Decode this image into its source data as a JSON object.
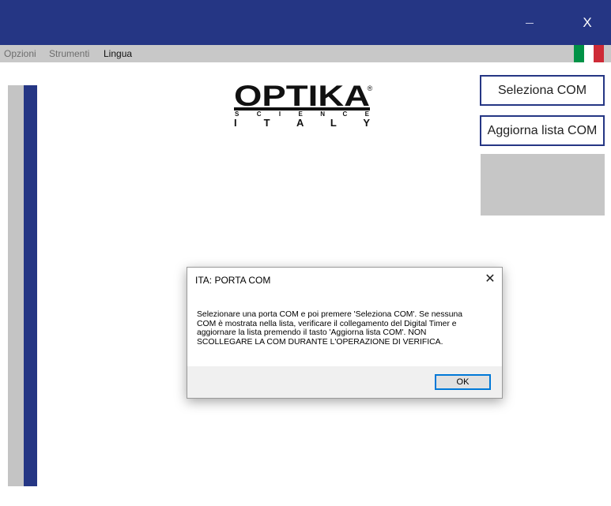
{
  "titlebar": {
    "minimize_label": "−",
    "close_label": "X",
    "color": "#253684"
  },
  "menu": {
    "items": [
      {
        "label": "Opzioni"
      },
      {
        "label": "Strumenti"
      },
      {
        "label": "Lingua"
      }
    ]
  },
  "flag": {
    "icon": "italian-flag-icon",
    "colors": [
      "#009246",
      "#ffffff",
      "#ce2b37"
    ]
  },
  "logo": {
    "brand": "OPTIKA",
    "registered": "®",
    "line2": "S C I E N C E",
    "line3": "I T A L Y"
  },
  "side": {
    "select_label": "Seleziona COM",
    "refresh_label": "Aggiorna lista COM"
  },
  "dialog": {
    "title": "ITA: PORTA COM",
    "close_label": "✕",
    "message_lines": [
      "Selezionare una porta COM e poi premere 'Seleziona COM'. Se nessuna",
      "COM è mostrata nella lista, verificare il collegamento del Digital Timer e",
      "aggiornare la lista premendo il tasto 'Aggiorna lista COM'. NON",
      "SCOLLEGARE LA COM DURANTE L'OPERAZIONE DI VERIFICA."
    ],
    "ok_label": "OK"
  },
  "colors": {
    "accent": "#253684",
    "bar_gray": "#c4c4c4",
    "focus_blue": "#0078d7"
  }
}
